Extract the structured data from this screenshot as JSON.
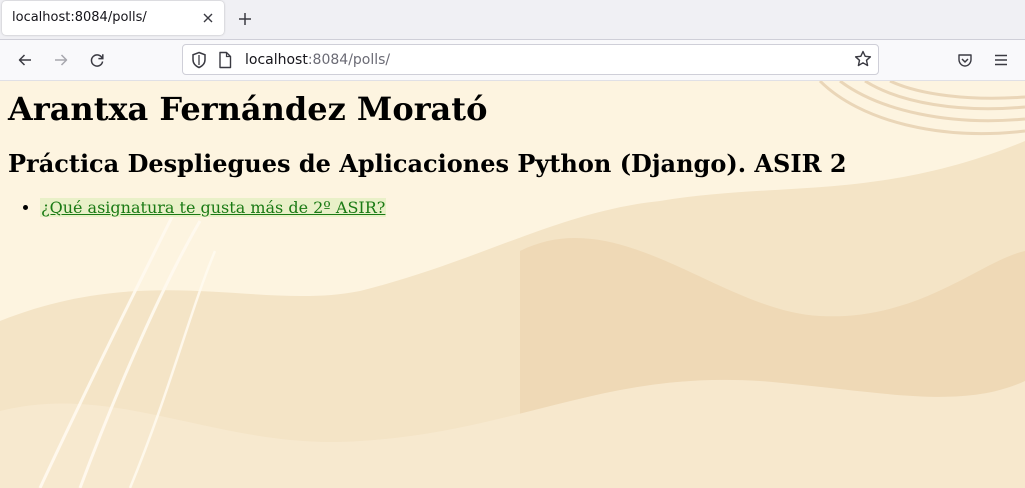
{
  "browser": {
    "tab": {
      "title": "localhost:8084/polls/"
    },
    "address": {
      "host": "localhost",
      "rest": ":8084/polls/"
    },
    "icons": {
      "close": "close-icon",
      "new_tab": "plus-icon",
      "back": "back-arrow-icon",
      "forward": "forward-arrow-icon",
      "reload": "reload-icon",
      "shield": "shield-icon",
      "page": "page-icon",
      "bookmark": "star-icon",
      "pocket": "pocket-icon",
      "menu": "hamburger-menu-icon"
    }
  },
  "page": {
    "author": "Arantxa Fernández Morató",
    "subtitle": "Práctica Despliegues de Aplicaciones Python (Django). ASIR 2",
    "polls": [
      {
        "question": "¿Qué asignatura te gusta más de 2º ASIR?"
      }
    ]
  },
  "colors": {
    "link": "#1a7a14",
    "background": "#fdf4e0"
  }
}
